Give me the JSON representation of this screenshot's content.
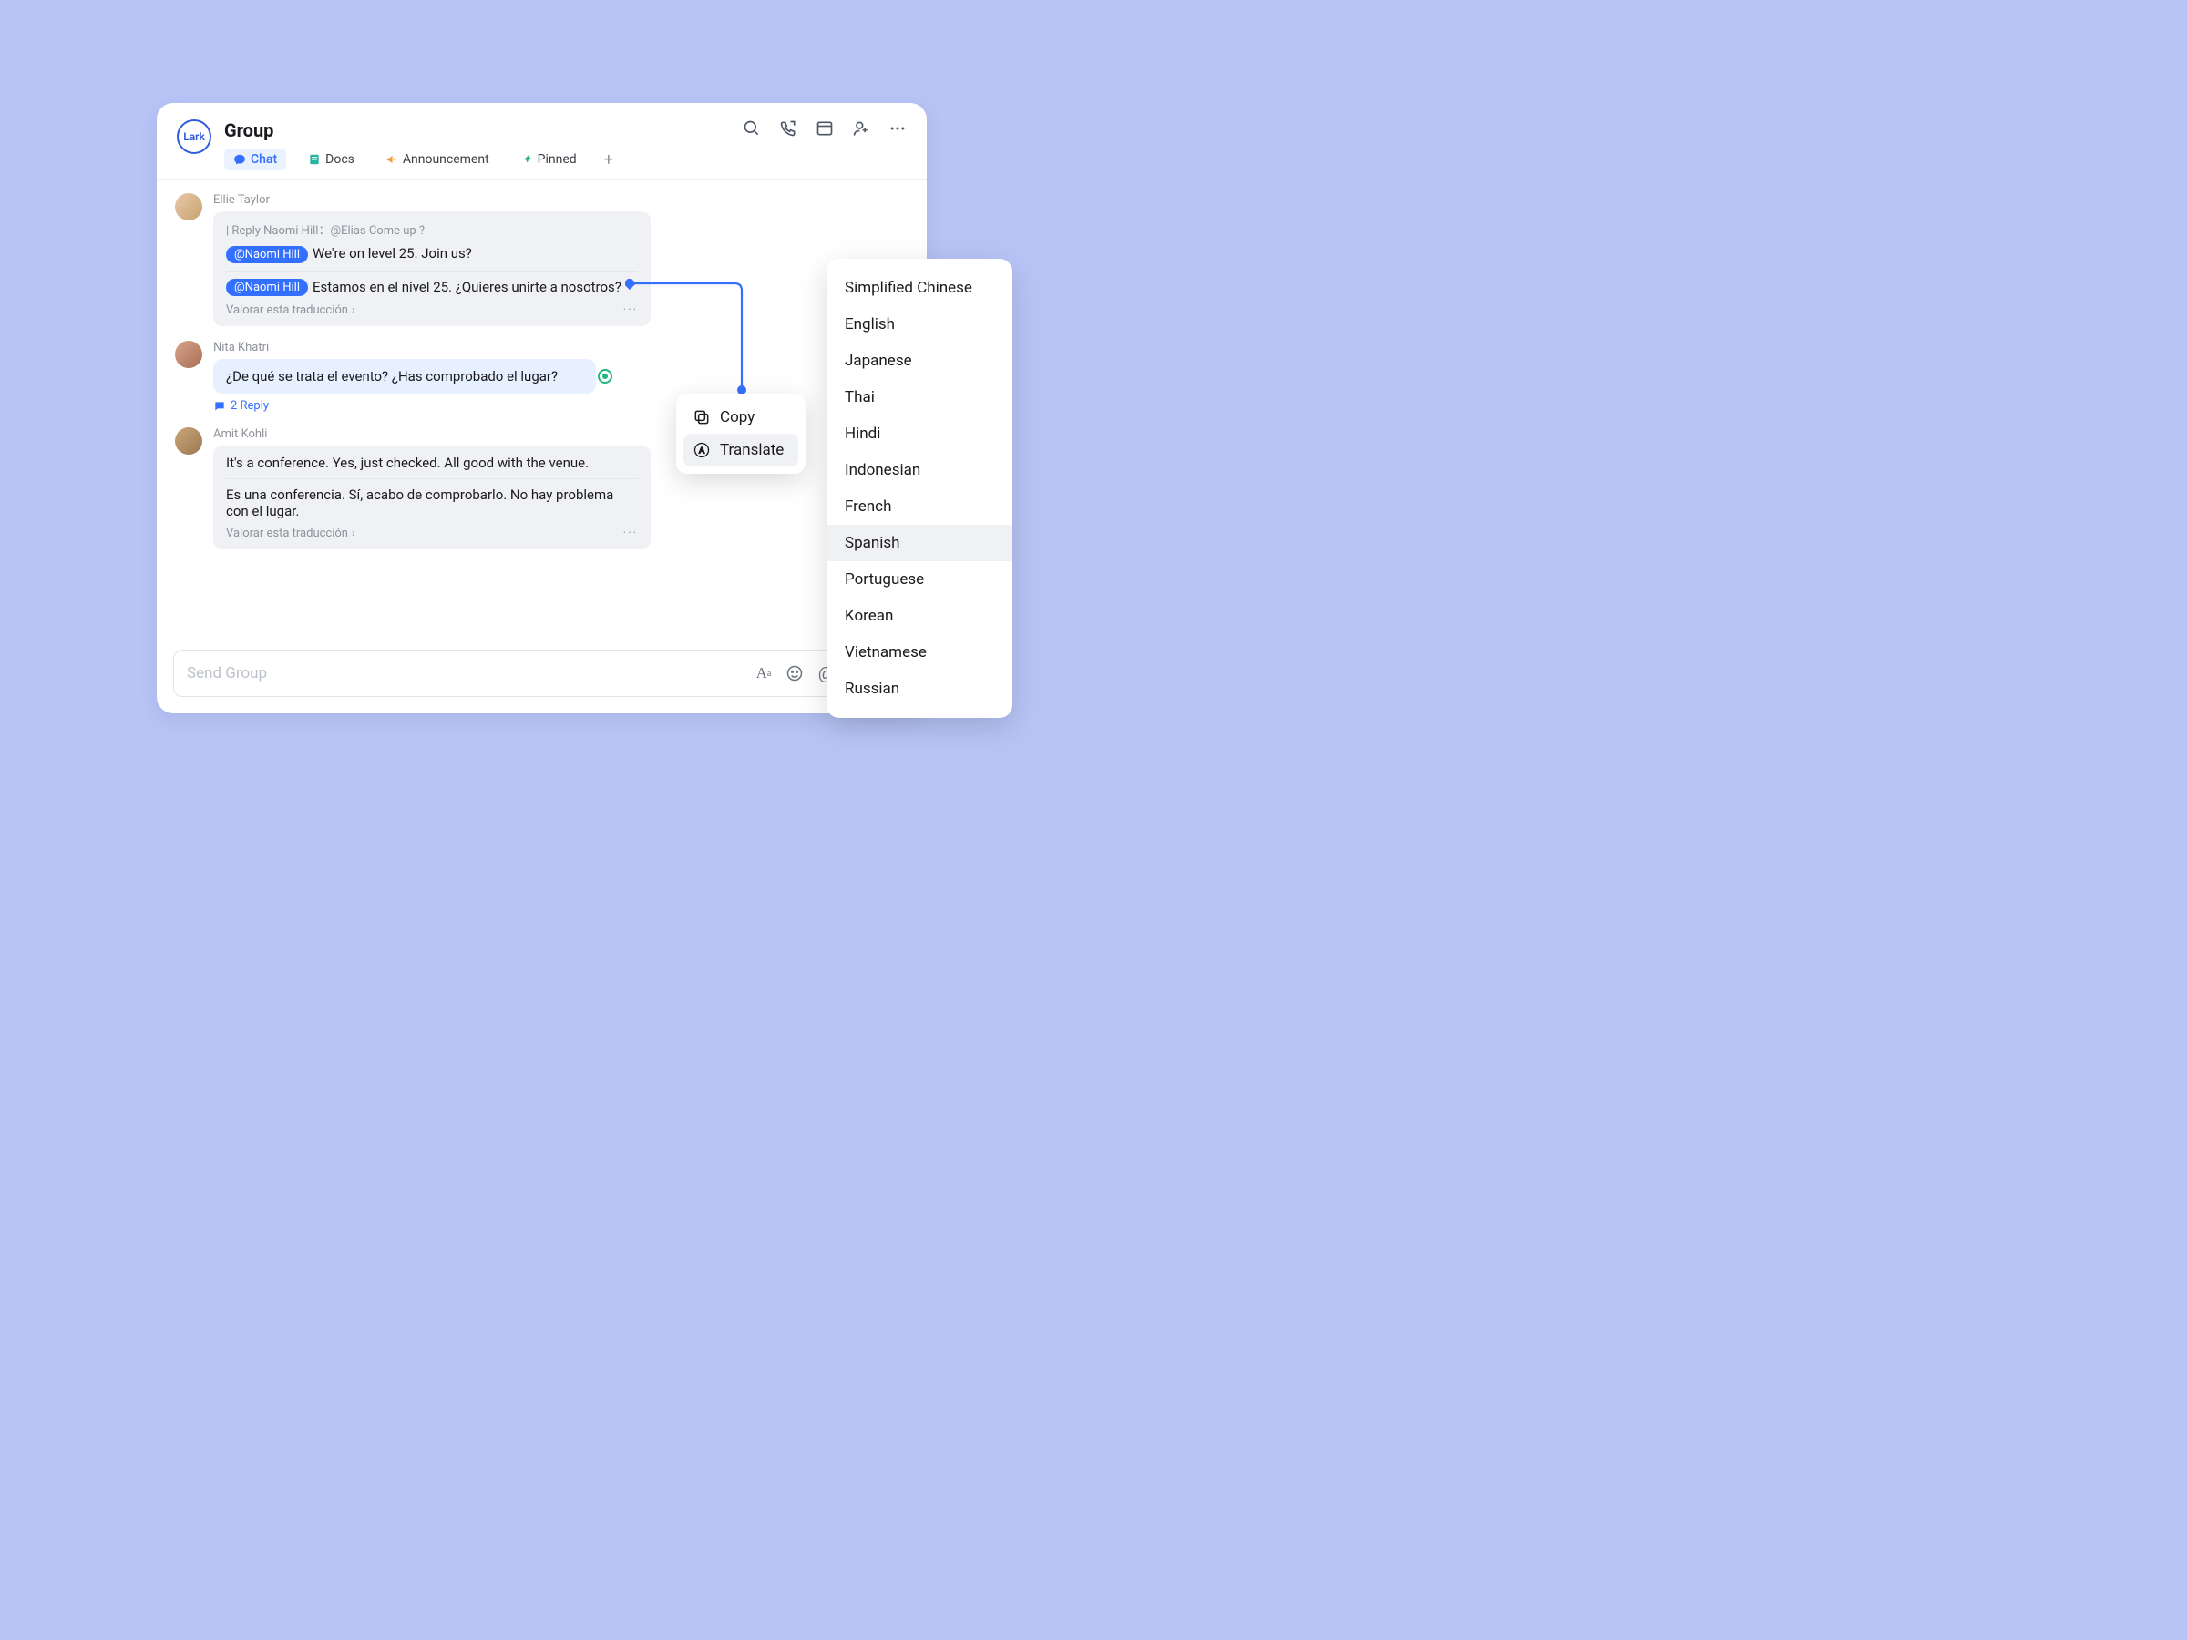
{
  "logo_text": "Lark",
  "header": {
    "title": "Group",
    "tabs": [
      {
        "label": "Chat"
      },
      {
        "label": "Docs"
      },
      {
        "label": "Announcement"
      },
      {
        "label": "Pinned"
      }
    ]
  },
  "messages": {
    "m1": {
      "sender": "Ellie Taylor",
      "reply_line": "| Reply Naomi Hill：@Elias Come up ?",
      "mention": "@Naomi Hill",
      "original": "We're on level 25. Join us?",
      "translated": "Estamos en el nivel 25. ¿Quieres unirte a nosotros?",
      "rate_label": "Valorar esta traducción"
    },
    "m2": {
      "sender": "Nita Khatri",
      "text": "¿De qué se trata el evento? ¿Has comprobado el lugar?",
      "reply_count": "2 Reply"
    },
    "m3": {
      "sender": "Amit Kohli",
      "original": "It's a conference. Yes, just checked. All good with the venue.",
      "translated": "Es una conferencia. Sí, acabo de comprobarlo. No hay problema con el lugar.",
      "rate_label": "Valorar esta traducción"
    }
  },
  "composer": {
    "placeholder": "Send Group"
  },
  "context_menu": {
    "copy": "Copy",
    "translate": "Translate"
  },
  "languages": [
    "Simplified Chinese",
    "English",
    "Japanese",
    "Thai",
    "Hindi",
    "Indonesian",
    "French",
    "Spanish",
    "Portuguese",
    "Korean",
    "Vietnamese",
    "Russian"
  ],
  "selected_language_index": 7
}
